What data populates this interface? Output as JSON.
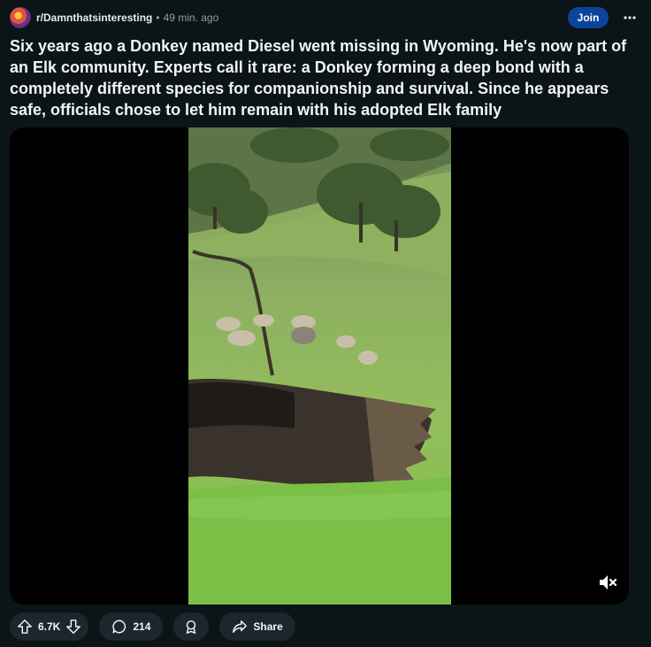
{
  "post": {
    "subreddit": "r/Damnthatsinteresting",
    "separator": "•",
    "age": "49 min. ago",
    "join_label": "Join",
    "more_label": "•••",
    "title": "Six years ago a Donkey named Diesel went missing in Wyoming. He's now part of an Elk community. Experts call it rare: a Donkey forming a deep bond with a completely different species for companionship and survival. Since he appears safe, officials chose to let him remain with his adopted Elk family"
  },
  "actions": {
    "score": "6.7K",
    "comments": "214",
    "share_label": "Share"
  },
  "icons": {
    "avatar": "subreddit-avatar",
    "upvote": "upvote-icon",
    "downvote": "downvote-icon",
    "comment": "comment-icon",
    "award": "award-icon",
    "share": "share-icon",
    "mute": "muted-speaker-icon"
  },
  "colors": {
    "background": "#0b1416",
    "join": "#0a449b",
    "pill": "#1a282d"
  }
}
